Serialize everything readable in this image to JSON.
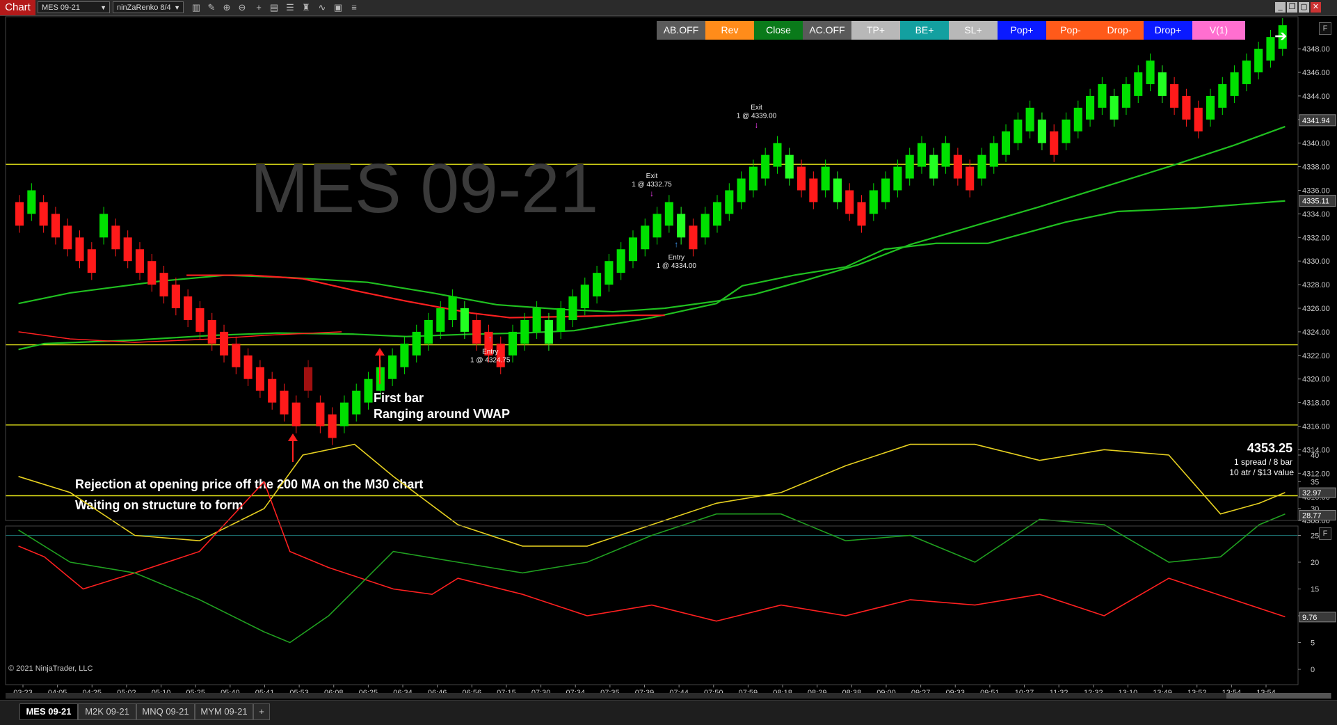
{
  "toolbar": {
    "chart_label": "Chart",
    "instrument": "MES 09-21",
    "bar_type": "ninZaRenko 8/4",
    "icons": [
      "bars-type-icon",
      "draw-tool-icon",
      "zoom-in-icon",
      "zoom-out-icon",
      "crosshair-icon",
      "data-box-icon",
      "properties-icon",
      "strategies-icon",
      "indicators-icon",
      "templates-icon",
      "list-icon"
    ]
  },
  "window": {
    "buttons": [
      "minimize",
      "restore",
      "maximize",
      "close"
    ]
  },
  "controls": [
    {
      "label": "AB.OFF",
      "bg": "#5a5a5a"
    },
    {
      "label": "Rev",
      "bg": "#ff8c1a"
    },
    {
      "label": "Close",
      "bg": "#0a7a1a"
    },
    {
      "label": "AC.OFF",
      "bg": "#5a5a5a"
    },
    {
      "label": "TP+",
      "bg": "#b8b8b8"
    },
    {
      "label": "BE+",
      "bg": "#13a0a0"
    },
    {
      "label": "SL+",
      "bg": "#b8b8b8"
    },
    {
      "label": "Pop+",
      "bg": "#0a1aff"
    },
    {
      "label": "Pop-",
      "bg": "#ff5a1a"
    },
    {
      "label": "Drop-",
      "bg": "#ff5a1a"
    },
    {
      "label": "Drop+",
      "bg": "#0a1aff"
    },
    {
      "label": "V(1)",
      "bg": "#ff6fd0"
    }
  ],
  "panel_button": "F",
  "watermark": "MES 09-21",
  "price_axis": {
    "ticks": [
      "4348.00",
      "4346.00",
      "4344.00",
      "4342.00",
      "4340.00",
      "4338.00",
      "4336.00",
      "4334.00",
      "4332.00",
      "4330.00",
      "4328.00",
      "4326.00",
      "4324.00",
      "4322.00",
      "4320.00",
      "4318.00",
      "4316.00",
      "4314.00",
      "4312.00",
      "4310.00",
      "4308.00"
    ],
    "markers": [
      {
        "label": "4341.94",
        "color": "#222",
        "text": "#fff"
      },
      {
        "label": "4335.11",
        "color": "#222",
        "text": "#fff"
      }
    ]
  },
  "indicator_axis": {
    "ticks": [
      "40",
      "35",
      "30",
      "25",
      "20",
      "15",
      "10",
      "5",
      "0"
    ],
    "markers": [
      {
        "label": "32.97",
        "color": "#333"
      },
      {
        "label": "28.77",
        "color": "#333"
      },
      {
        "label": "9.76",
        "color": "#333"
      }
    ]
  },
  "time_axis": [
    "03:23",
    "04:05",
    "04:25",
    "05:02",
    "05:10",
    "05:25",
    "05:40",
    "05:41",
    "05:53",
    "06:08",
    "06:25",
    "06:34",
    "06:46",
    "06:56",
    "07:15",
    "07:30",
    "07:34",
    "07:35",
    "07:39",
    "07:44",
    "07:50",
    "07:59",
    "08:18",
    "08:29",
    "08:38",
    "09:00",
    "09:27",
    "09:33",
    "09:51",
    "10:27",
    "11:32",
    "12:32",
    "13:10",
    "13:49",
    "13:52",
    "13:54",
    "13:54"
  ],
  "trades": [
    {
      "kind": "Exit",
      "label": "Exit",
      "detail": "1 @ 4332.75"
    },
    {
      "kind": "Exit",
      "label": "Exit",
      "detail": "1 @ 4339.00"
    },
    {
      "kind": "Entry",
      "label": "Entry",
      "detail": "1 @ 4334.00"
    },
    {
      "kind": "Entry",
      "label": "Entry",
      "detail": "1 @ 4324.75"
    }
  ],
  "annotations": {
    "first_bar": "First bar",
    "ranging": "Ranging around VWAP",
    "rejection": "Rejection at opening price off the 200 MA on the M30 chart",
    "waiting": "Waiting on structure to form"
  },
  "info_box": {
    "price": "4353.25",
    "line1": "1 spread / 8 bar",
    "line2": "10 atr / $13 value"
  },
  "copyright": "© 2021 NinjaTrader, LLC",
  "tabs": [
    "MES 09-21",
    "M2K 09-21",
    "MNQ 09-21",
    "MYM 09-21",
    "+"
  ],
  "colors": {
    "bull": "#00e000",
    "bull_strong": "#22ff22",
    "bear": "#ff1a1a",
    "bear_dark": "#a01010",
    "hline": "#e6e61a",
    "vwap": "#ff2020",
    "ma_green": "#20c020",
    "osc_yellow": "#e6d020",
    "osc_red": "#ff2020",
    "osc_green": "#20a020"
  }
}
